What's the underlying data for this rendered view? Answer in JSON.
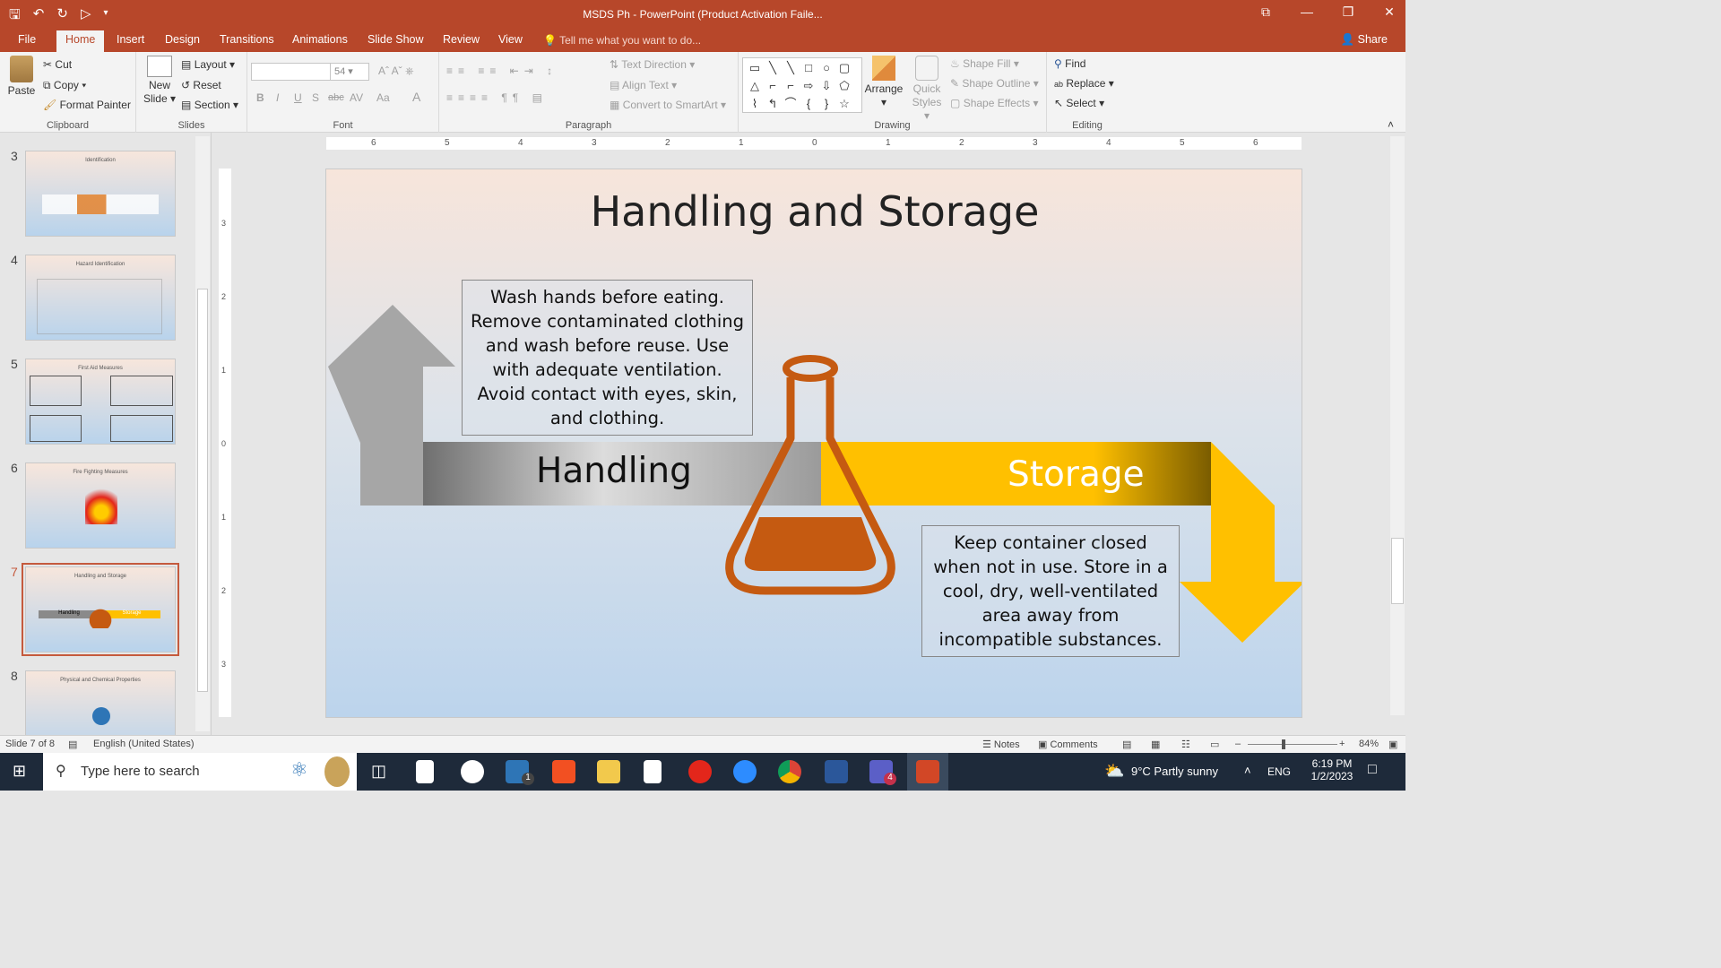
{
  "titlebar": {
    "title": "MSDS Ph - PowerPoint (Product Activation Faile...",
    "qat_icons": [
      "save-icon",
      "undo-icon",
      "redo-icon",
      "present-icon",
      "customize-icon"
    ],
    "win_icons": [
      "restore-icon",
      "minimize-icon",
      "maximize-icon",
      "close-icon"
    ]
  },
  "tabs": [
    "File",
    "Home",
    "Insert",
    "Design",
    "Transitions",
    "Animations",
    "Slide Show",
    "Review",
    "View"
  ],
  "tell_me": "Tell me what you want to do...",
  "share": "Share",
  "ribbon": {
    "clipboard": {
      "label": "Clipboard",
      "paste": "Paste",
      "cut": "Cut",
      "copy": "Copy",
      "format_painter": "Format Painter"
    },
    "slides": {
      "label": "Slides",
      "new_slide_1": "New",
      "new_slide_2": "Slide",
      "layout": "Layout",
      "reset": "Reset",
      "section": "Section"
    },
    "font": {
      "label": "Font",
      "size": "54",
      "buttons": [
        "B",
        "I",
        "U",
        "S",
        "abc",
        "AV",
        "Aa",
        "A"
      ]
    },
    "paragraph": {
      "label": "Paragraph",
      "text_direction": "Text Direction",
      "align_text": "Align Text",
      "smartart": "Convert to SmartArt"
    },
    "drawing": {
      "label": "Drawing",
      "arrange": "Arrange",
      "quick_styles_1": "Quick",
      "quick_styles_2": "Styles",
      "shape_fill": "Shape Fill",
      "shape_outline": "Shape Outline",
      "shape_effects": "Shape Effects",
      "shapes": [
        "▭",
        "╲",
        "╲",
        "□",
        "○",
        "▢",
        "△",
        "⌐",
        "⌐",
        "⇨",
        "⇩",
        "⬠",
        "⌇",
        "↰",
        "⌒",
        "{",
        "}",
        "☆"
      ]
    },
    "editing": {
      "label": "Editing",
      "find": "Find",
      "replace": "Replace",
      "select": "Select"
    }
  },
  "thumbnails": [
    {
      "num": "3",
      "title": "Identification"
    },
    {
      "num": "4",
      "title": "Hazard Identification"
    },
    {
      "num": "5",
      "title": "First Aid Measures"
    },
    {
      "num": "6",
      "title": "Fire Fighting Measures"
    },
    {
      "num": "7",
      "title": "Handling and Storage",
      "handling": "Handling",
      "storage": "Storage"
    },
    {
      "num": "8",
      "title": "Physical and Chemical Properties"
    }
  ],
  "ruler": {
    "labels": [
      "6",
      "5",
      "4",
      "3",
      "2",
      "1",
      "0",
      "1",
      "2",
      "3",
      "4",
      "5",
      "6"
    ],
    "vlabels": [
      "3",
      "2",
      "1",
      "0",
      "1",
      "2",
      "3"
    ]
  },
  "slide": {
    "title": "Handling and Storage",
    "handling_text": "Wash hands before eating. Remove contaminated clothing and wash before reuse. Use with adequate ventilation. Avoid contact with eyes, skin, and clothing.",
    "handling_label": "Handling",
    "storage_label": "Storage",
    "storage_text": "Keep container closed when not in use. Store in a cool, dry, well-ventilated area away from incompatible substances.",
    "colors": {
      "gray_arrow": "#a6a6a6",
      "storage_arrow": "#ffc000",
      "flask": "#c55a11"
    }
  },
  "status": {
    "slide_of": "Slide 7 of 8",
    "language": "English (United States)",
    "notes": "Notes",
    "comments": "Comments",
    "zoom": "84%"
  },
  "taskbar": {
    "search_placeholder": "Type here to search",
    "weather": "9°C  Partly sunny",
    "lang": "ENG",
    "time": "6:19 PM",
    "date": "1/2/2023",
    "mail_badge": "1",
    "teams_badge": "4"
  }
}
